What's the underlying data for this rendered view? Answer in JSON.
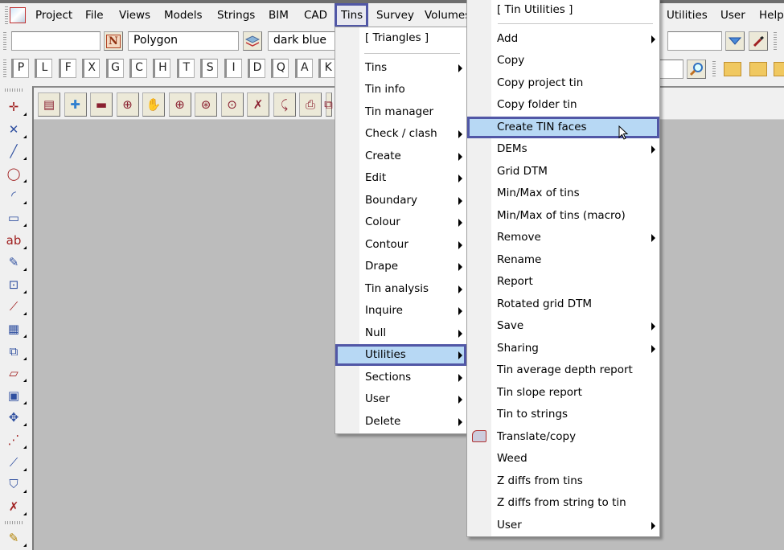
{
  "menubar": {
    "items": [
      "Project",
      "File",
      "Views",
      "Models",
      "Strings",
      "BIM",
      "CAD",
      "Tins",
      "Survey",
      "Volumes"
    ],
    "right_items": [
      "Utilities",
      "User",
      "Help"
    ]
  },
  "toolbar": {
    "name_value": "",
    "n_button": "N",
    "string_type": "Polygon",
    "colour": "dark blue",
    "right_value": "",
    "search_value": ""
  },
  "letters": [
    "P",
    "L",
    "F",
    "X",
    "G",
    "C",
    "H",
    "T",
    "S",
    "I",
    "D",
    "Q",
    "A",
    "K"
  ],
  "tins_menu": {
    "header": "[ Triangles ]",
    "items": [
      {
        "label": "Tins",
        "sub": true
      },
      {
        "label": "Tin info",
        "sub": false
      },
      {
        "label": "Tin manager",
        "sub": false
      },
      {
        "label": "Check / clash",
        "sub": true
      },
      {
        "label": "Create",
        "sub": true
      },
      {
        "label": "Edit",
        "sub": true
      },
      {
        "label": "Boundary",
        "sub": true
      },
      {
        "label": "Colour",
        "sub": true
      },
      {
        "label": "Contour",
        "sub": true
      },
      {
        "label": "Drape",
        "sub": true
      },
      {
        "label": "Tin analysis",
        "sub": true
      },
      {
        "label": "Inquire",
        "sub": true
      },
      {
        "label": "Null",
        "sub": true
      },
      {
        "label": "Utilities",
        "sub": true,
        "highlighted": true
      },
      {
        "label": "Sections",
        "sub": true
      },
      {
        "label": "User",
        "sub": true
      },
      {
        "label": "Delete",
        "sub": true
      }
    ]
  },
  "utilities_menu": {
    "header": "[ Tin Utilities ]",
    "items": [
      {
        "label": "Add",
        "sub": true
      },
      {
        "label": "Copy",
        "sub": false
      },
      {
        "label": "Copy project tin",
        "sub": false
      },
      {
        "label": "Copy folder tin",
        "sub": false
      },
      {
        "label": "Create TIN faces",
        "sub": false,
        "highlighted": true
      },
      {
        "label": "DEMs",
        "sub": true
      },
      {
        "label": "Grid DTM",
        "sub": false
      },
      {
        "label": "Min/Max of tins",
        "sub": false
      },
      {
        "label": "Min/Max of tins (macro)",
        "sub": false
      },
      {
        "label": "Remove",
        "sub": true
      },
      {
        "label": "Rename",
        "sub": false
      },
      {
        "label": "Report",
        "sub": false
      },
      {
        "label": "Rotated grid DTM",
        "sub": false
      },
      {
        "label": "Save",
        "sub": true
      },
      {
        "label": "Sharing",
        "sub": true
      },
      {
        "label": "Tin average depth report",
        "sub": false
      },
      {
        "label": "Tin slope report",
        "sub": false
      },
      {
        "label": "Tin to strings",
        "sub": false
      },
      {
        "label": "Translate/copy",
        "sub": false,
        "icon": "translate-copy-icon"
      },
      {
        "label": "Weed",
        "sub": false
      },
      {
        "label": "Z diffs from tins",
        "sub": false
      },
      {
        "label": "Z diffs from string to tin",
        "sub": false
      },
      {
        "label": "User",
        "sub": true
      }
    ]
  },
  "colors": {
    "highlight": "#b7d8f4",
    "highlight_border": "#5157a6",
    "canvas": "#bcbcbc"
  }
}
